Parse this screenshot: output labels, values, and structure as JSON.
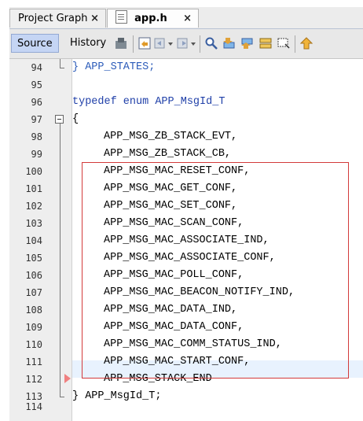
{
  "tabs": [
    {
      "label": "Project Graph",
      "close": "×",
      "active": false
    },
    {
      "label": "app.h",
      "close": "×",
      "active": true
    }
  ],
  "toolbar": {
    "source_label": "Source",
    "history_label": "History",
    "icons": [
      "last-edit-icon",
      "back-icon",
      "dropdown-icon",
      "forward-icon",
      "dropdown-icon",
      "find-icon",
      "find-previous-icon",
      "find-next-icon",
      "toggle-highlight-icon",
      "select-rect-icon",
      "next-bookmark-icon"
    ]
  },
  "editor": {
    "lines": [
      {
        "num": "94",
        "text": "} APP_STATES;"
      },
      {
        "num": "95",
        "text": ""
      },
      {
        "num": "96",
        "text": "typedef enum APP_MsgId_T"
      },
      {
        "num": "97",
        "text": "{"
      },
      {
        "num": "98",
        "text": "APP_MSG_ZB_STACK_EVT,"
      },
      {
        "num": "99",
        "text": "APP_MSG_ZB_STACK_CB,"
      },
      {
        "num": "100",
        "text": "APP_MSG_MAC_RESET_CONF,"
      },
      {
        "num": "101",
        "text": "APP_MSG_MAC_GET_CONF,"
      },
      {
        "num": "102",
        "text": "APP_MSG_MAC_SET_CONF,"
      },
      {
        "num": "103",
        "text": "APP_MSG_MAC_SCAN_CONF,"
      },
      {
        "num": "104",
        "text": "APP_MSG_MAC_ASSOCIATE_IND,"
      },
      {
        "num": "105",
        "text": "APP_MSG_MAC_ASSOCIATE_CONF,"
      },
      {
        "num": "106",
        "text": "APP_MSG_MAC_POLL_CONF,"
      },
      {
        "num": "107",
        "text": "APP_MSG_MAC_BEACON_NOTIFY_IND,"
      },
      {
        "num": "108",
        "text": "APP_MSG_MAC_DATA_IND,"
      },
      {
        "num": "109",
        "text": "APP_MSG_MAC_DATA_CONF,"
      },
      {
        "num": "110",
        "text": "APP_MSG_MAC_COMM_STATUS_IND,"
      },
      {
        "num": "111",
        "text": "APP_MSG_MAC_START_CONF,"
      },
      {
        "num": "112",
        "text": "APP_MSG_STACK_END"
      },
      {
        "num": "113",
        "text": "} APP_MsgId_T;"
      },
      {
        "num": "114",
        "text": ""
      }
    ],
    "highlight_color": "#d33a3a",
    "current_line_color": "#e8f2fe"
  }
}
